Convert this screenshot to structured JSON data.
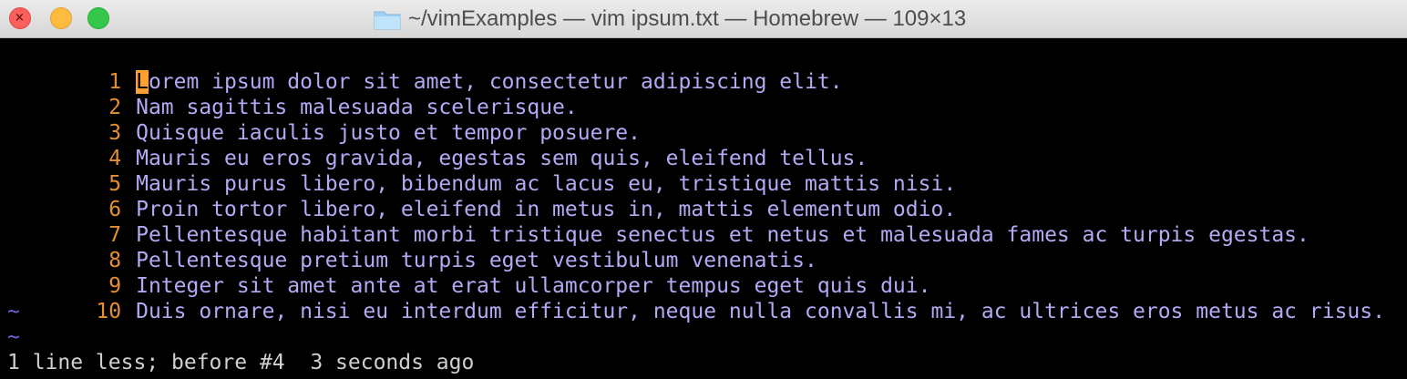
{
  "window": {
    "title": "~/vimExamples — vim ipsum.txt — Homebrew — 109×13",
    "close_glyph": "×"
  },
  "editor": {
    "cursor_char": "L",
    "lines": [
      {
        "num": "1",
        "text": "orem ipsum dolor sit amet, consectetur adipiscing elit."
      },
      {
        "num": "2",
        "text": "Nam sagittis malesuada scelerisque."
      },
      {
        "num": "3",
        "text": "Quisque iaculis justo et tempor posuere."
      },
      {
        "num": "4",
        "text": "Mauris eu eros gravida, egestas sem quis, eleifend tellus."
      },
      {
        "num": "5",
        "text": "Mauris purus libero, bibendum ac lacus eu, tristique mattis nisi."
      },
      {
        "num": "6",
        "text": "Proin tortor libero, eleifend in metus in, mattis elementum odio."
      },
      {
        "num": "7",
        "text": "Pellentesque habitant morbi tristique senectus et netus et malesuada fames ac turpis egestas."
      },
      {
        "num": "8",
        "text": "Pellentesque pretium turpis eget vestibulum venenatis."
      },
      {
        "num": "9",
        "text": "Integer sit amet ante at erat ullamcorper tempus eget quis dui."
      },
      {
        "num": "10",
        "text": "Duis ornare, nisi eu interdum efficitur, neque nulla convallis mi, ac ultrices eros metus ac risus."
      }
    ],
    "empty_markers": [
      "~",
      "~"
    ],
    "status": "1 line less; before #4  3 seconds ago"
  },
  "colors": {
    "line_number": "#e5902f",
    "text": "#b7a8f5",
    "tilde": "#6f60d8",
    "cursor": "#ff9f30"
  }
}
